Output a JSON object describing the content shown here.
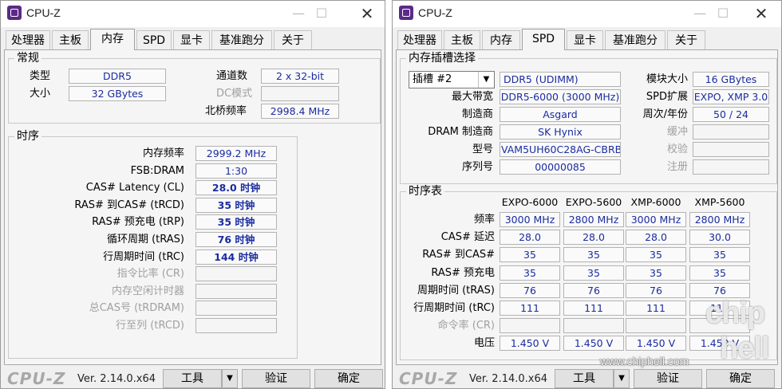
{
  "app": {
    "title": "CPU-Z",
    "brand": "CPU-Z",
    "version": "Ver. 2.14.0.x64"
  },
  "tabs": [
    "处理器",
    "主板",
    "内存",
    "SPD",
    "显卡",
    "基准跑分",
    "关于"
  ],
  "footer": {
    "tools_label": "工具",
    "validate_label": "验证",
    "ok_label": "确定"
  },
  "memory": {
    "general": {
      "title": "常规",
      "type_label": "类型",
      "type_value": "DDR5",
      "size_label": "大小",
      "size_value": "32 GBytes",
      "channels_label": "通道数",
      "channels_value": "2 x 32-bit",
      "dc_mode_label": "DC模式",
      "dc_mode_value": "",
      "nb_freq_label": "北桥频率",
      "nb_freq_value": "2998.4 MHz"
    },
    "timings": {
      "title": "时序",
      "rows": [
        {
          "label": "内存频率",
          "value": "2999.2 MHz",
          "bold": false,
          "grey": false
        },
        {
          "label": "FSB:DRAM",
          "value": "1:30",
          "bold": false,
          "grey": false
        },
        {
          "label": "CAS# Latency (CL)",
          "value": "28.0 时钟",
          "bold": true,
          "grey": false
        },
        {
          "label": "RAS# 到CAS# (tRCD)",
          "value": "35 时钟",
          "bold": true,
          "grey": false
        },
        {
          "label": "RAS# 预充电 (tRP)",
          "value": "35 时钟",
          "bold": true,
          "grey": false
        },
        {
          "label": "循环周期 (tRAS)",
          "value": "76 时钟",
          "bold": true,
          "grey": false
        },
        {
          "label": "行周期时间 (tRC)",
          "value": "144 时钟",
          "bold": true,
          "grey": false
        },
        {
          "label": "指令比率 (CR)",
          "value": "",
          "bold": false,
          "grey": true
        },
        {
          "label": "内存空闲计时器",
          "value": "",
          "bold": false,
          "grey": true
        },
        {
          "label": "总CAS号 (tRDRAM)",
          "value": "",
          "bold": false,
          "grey": true
        },
        {
          "label": "行至列 (tRCD)",
          "value": "",
          "bold": false,
          "grey": true
        }
      ]
    }
  },
  "spd": {
    "slot": {
      "title": "内存插槽选择",
      "selected": "插槽 #2",
      "type_value": "DDR5 (UDIMM)",
      "module_size_label": "模块大小",
      "module_size_value": "16 GBytes",
      "max_bw_label": "最大带宽",
      "max_bw_value": "DDR5-6000 (3000 MHz)",
      "spd_ext_label": "SPD扩展",
      "spd_ext_value": "EXPO, XMP 3.0",
      "manufacturer_label": "制造商",
      "manufacturer_value": "Asgard",
      "week_year_label": "周次/年份",
      "week_year_value": "50 / 24",
      "dram_mfr_label": "DRAM 制造商",
      "dram_mfr_value": "SK Hynix",
      "buffered_label": "缓冲",
      "buffered_value": "",
      "part_label": "型号",
      "part_value": "VAM5UH60C28AG-CBRBWA",
      "correction_label": "校验",
      "correction_value": "",
      "serial_label": "序列号",
      "serial_value": "00000085",
      "registered_label": "注册",
      "registered_value": ""
    },
    "timings": {
      "title": "时序表",
      "columns": [
        "EXPO-6000",
        "EXPO-5600",
        "XMP-6000",
        "XMP-5600"
      ],
      "rows": [
        {
          "label": "频率",
          "values": [
            "3000 MHz",
            "2800 MHz",
            "3000 MHz",
            "2800 MHz"
          ],
          "grey": false
        },
        {
          "label": "CAS# 延迟",
          "values": [
            "28.0",
            "28.0",
            "28.0",
            "30.0"
          ],
          "grey": false
        },
        {
          "label": "RAS# 到CAS#",
          "values": [
            "35",
            "35",
            "35",
            "35"
          ],
          "grey": false
        },
        {
          "label": "RAS# 预充电",
          "values": [
            "35",
            "35",
            "35",
            "35"
          ],
          "grey": false
        },
        {
          "label": "周期时间 (tRAS)",
          "values": [
            "76",
            "76",
            "76",
            "76"
          ],
          "grey": false
        },
        {
          "label": "行周期时间 (tRC)",
          "values": [
            "111",
            "111",
            "111",
            "111"
          ],
          "grey": false
        },
        {
          "label": "命令率 (CR)",
          "values": [
            "",
            "",
            "",
            ""
          ],
          "grey": true
        },
        {
          "label": "电压",
          "values": [
            "1.450 V",
            "1.450 V",
            "1.450 V",
            "1.450 V"
          ],
          "grey": false
        }
      ]
    }
  },
  "watermark": {
    "url": "www.chiphell.com",
    "logo": "chip hell"
  }
}
